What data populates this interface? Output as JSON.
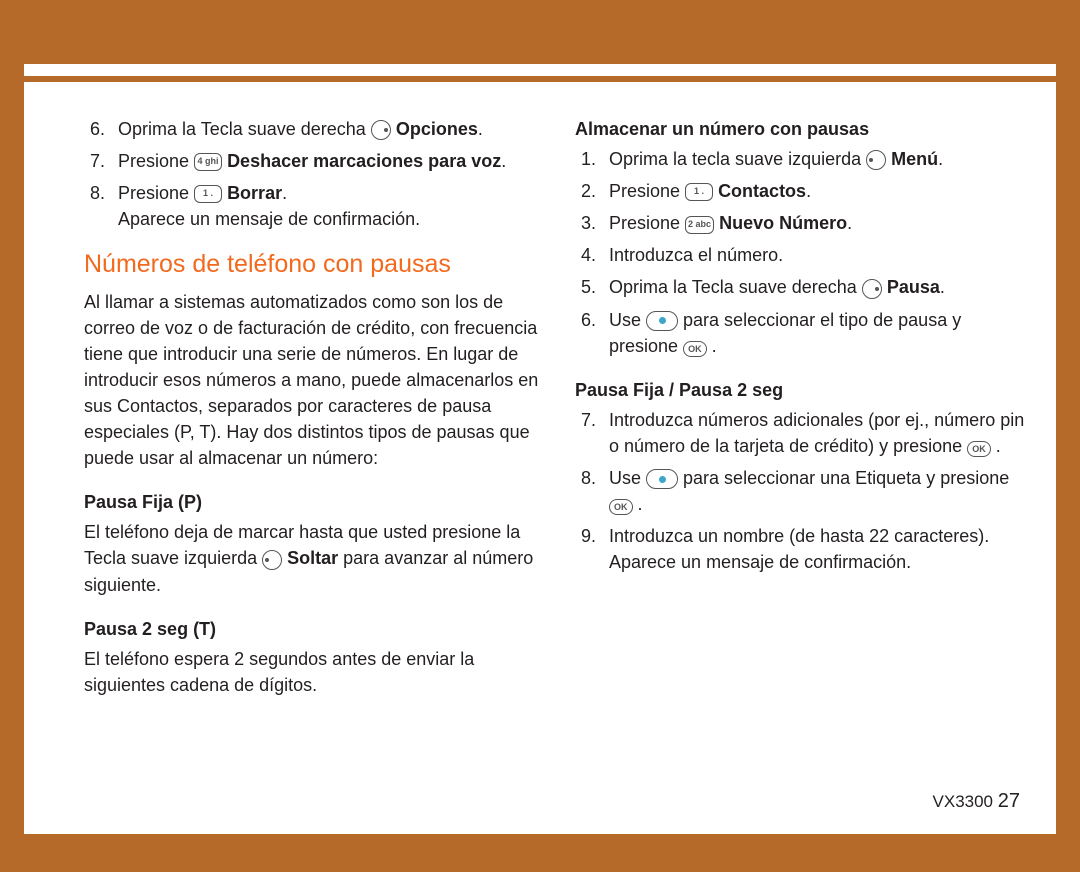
{
  "leftColumn": {
    "steps": {
      "start": 6,
      "s6_prefix": "Oprima la Tecla suave derecha ",
      "s6_bold": "Opciones",
      "s7_prefix": "Presione ",
      "s7_key": "4 ghi",
      "s7_bold": "Deshacer marcaciones para voz",
      "s8_prefix": "Presione ",
      "s8_key": "1 .",
      "s8_bold": "Borrar",
      "s8_note": "Aparece un mensaje de confirmación."
    },
    "sectionTitle": "Números de teléfono con pausas",
    "intro": "Al llamar a sistemas automatizados como son los de correo de voz o de facturación de crédito, con frecuencia tiene que introducir una serie de números. En lugar de introducir esos números a mano, puede almacenarlos en sus Contactos, separados por caracteres de pausa especiales (P, T). Hay dos distintos tipos de pausas que puede usar al almacenar un número:",
    "pausaFijaTitle": "Pausa Fija (P)",
    "pausaFija_before": "El teléfono deja de marcar hasta que usted presione la Tecla suave izquierda ",
    "pausaFija_boldWord": "Soltar",
    "pausaFija_after": " para avanzar al número siguiente.",
    "pausa2Title": "Pausa 2 seg (T)",
    "pausa2Body": "El teléfono espera 2 segundos antes de enviar la siguientes cadena de dígitos."
  },
  "rightColumn": {
    "subhead": "Almacenar un número con pausas",
    "s1_prefix": "Oprima la tecla suave izquierda ",
    "s1_bold": "Menú",
    "s2_prefix": "Presione ",
    "s2_key": "1 .",
    "s2_bold": "Contactos",
    "s3_prefix": "Presione ",
    "s3_key": "2 abc",
    "s3_bold": "Nuevo Número",
    "s4": "Introduzca el número.",
    "s5_prefix": "Oprima la Tecla suave derecha ",
    "s5_bold": "Pausa",
    "s6_before": "Use ",
    "s6_mid": " para seleccionar el tipo de pausa y presione ",
    "subhead2": "Pausa Fija / Pausa 2 seg",
    "s7_before": "Introduzca números adicionales (por ej., número pin o número de la tarjeta de crédito) y presione ",
    "s8_before": "Use ",
    "s8_mid": " para seleccionar una Etiqueta y presione ",
    "s9": "Introduzca un nombre (de hasta 22 caracteres). Aparece un mensaje de confirmación."
  },
  "footer": {
    "model": "VX3300",
    "page": "27"
  }
}
